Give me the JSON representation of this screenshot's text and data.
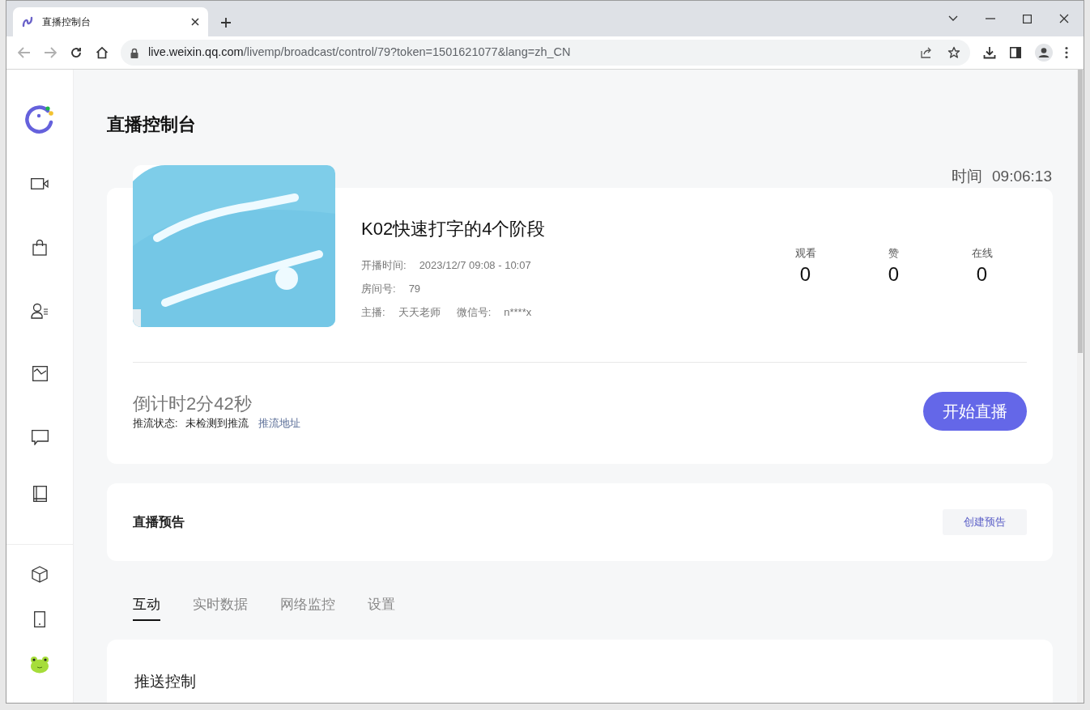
{
  "browser": {
    "tab_title": "直播控制台",
    "url_host": "live.weixin.qq.com",
    "url_path": "/livemp/broadcast/control/79?token=1501621077&lang=zh_CN"
  },
  "page_title": "直播控制台",
  "time": {
    "label": "时间",
    "value": "09:06:13"
  },
  "live": {
    "title": "K02快速打字的4个阶段",
    "meta": [
      {
        "label": "开播时间:",
        "value": "2023/12/7 09:08 - 10:07"
      },
      {
        "label": "房间号:",
        "value": "79"
      }
    ],
    "host_label": "主播:",
    "host": "天天老师",
    "wechat_label": "微信号:",
    "wechat": "n****x",
    "stats": [
      {
        "label": "观看",
        "value": "0"
      },
      {
        "label": "赞",
        "value": "0"
      },
      {
        "label": "在线",
        "value": "0"
      }
    ],
    "countdown": "倒计时2分42秒",
    "stream_label": "推流状态:",
    "stream_status": "未检测到推流",
    "stream_link": "推流地址",
    "start_button": "开始直播"
  },
  "preview": {
    "title": "直播预告",
    "button": "创建预告"
  },
  "tabs": [
    {
      "label": "互动",
      "selected": true
    },
    {
      "label": "实时数据",
      "selected": false
    },
    {
      "label": "网络监控",
      "selected": false
    },
    {
      "label": "设置",
      "selected": false
    }
  ],
  "section_title": "推送控制"
}
